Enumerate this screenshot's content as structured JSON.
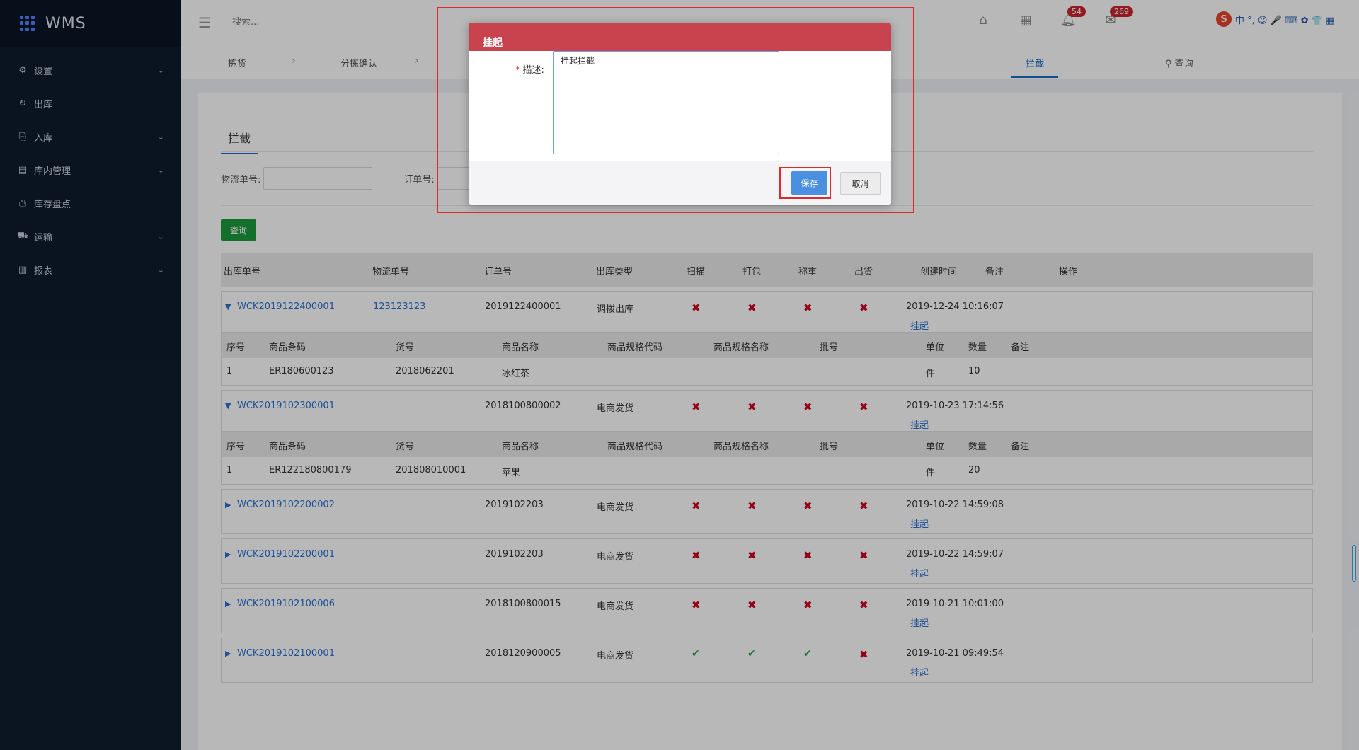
{
  "app": {
    "title": "WMS"
  },
  "sidebar": {
    "items": [
      {
        "label": "设置",
        "icon": "gear-icon",
        "glyph": "⚙",
        "chev": "⌄"
      },
      {
        "label": "出库",
        "icon": "outbound-icon",
        "glyph": "↻",
        "chev": ""
      },
      {
        "label": "入库",
        "icon": "inbound-icon",
        "glyph": "⎘",
        "chev": "⌄"
      },
      {
        "label": "库内管理",
        "icon": "warehouse-icon",
        "glyph": "▤",
        "chev": "⌄"
      },
      {
        "label": "库存盘点",
        "icon": "inventory-icon",
        "glyph": "⎙",
        "chev": ""
      },
      {
        "label": "运输",
        "icon": "truck-icon",
        "glyph": "⛟",
        "chev": "⌄"
      },
      {
        "label": "报表",
        "icon": "chart-icon",
        "glyph": "▥",
        "chev": "⌄"
      }
    ]
  },
  "topbar": {
    "search_placeholder": "搜索...",
    "badge_notify": "54",
    "badge_mail": "269"
  },
  "ime": {
    "s": "S",
    "text": "中 °, ☺ 🎤 ⌨ ✿ 👕 ▦"
  },
  "tabs": {
    "pick": "拣货",
    "sort_confirm": "分拣确认",
    "intercept": "拦截",
    "query": "查询",
    "arrow": "›"
  },
  "section": {
    "tab": "拦截"
  },
  "form": {
    "logistics_label": "物流单号:",
    "order_label": "订单号:",
    "query_button": "查询"
  },
  "table": {
    "headers": [
      "出库单号",
      "物流单号",
      "订单号",
      "出库类型",
      "扫描",
      "打包",
      "称重",
      "出货",
      "创建时间",
      "备注",
      "操作"
    ],
    "sub_headers": [
      "序号",
      "商品条码",
      "货号",
      "商品名称",
      "商品规格代码",
      "商品规格名称",
      "批号",
      "单位",
      "数量",
      "备注"
    ],
    "action": "挂起",
    "tri_down": "▼",
    "tri_right": "▶",
    "x_mark": "✖",
    "check_mark": "✔",
    "rows": [
      {
        "no": "WCK2019122400001",
        "logistics": "123123123",
        "order": "2019122400001",
        "type": "调拨出库",
        "marks": [
          "x",
          "x",
          "x",
          "x"
        ],
        "time": "2019-12-24 10:16:07",
        "expanded": true,
        "items": [
          {
            "seq": "1",
            "barcode": "ER180600123",
            "sku": "2018062201",
            "name": "冰红茶",
            "unit": "件",
            "qty": "10"
          }
        ]
      },
      {
        "no": "WCK2019102300001",
        "logistics": "",
        "order": "2018100800002",
        "type": "电商发货",
        "marks": [
          "x",
          "x",
          "x",
          "x"
        ],
        "time": "2019-10-23 17:14:56",
        "expanded": true,
        "items": [
          {
            "seq": "1",
            "barcode": "ER122180800179",
            "sku": "201808010001",
            "name": "苹果",
            "unit": "件",
            "qty": "20"
          }
        ]
      },
      {
        "no": "WCK2019102200002",
        "logistics": "",
        "order": "2019102203",
        "type": "电商发货",
        "marks": [
          "x",
          "x",
          "x",
          "x"
        ],
        "time": "2019-10-22 14:59:08",
        "expanded": false
      },
      {
        "no": "WCK2019102200001",
        "logistics": "",
        "order": "2019102203",
        "type": "电商发货",
        "marks": [
          "x",
          "x",
          "x",
          "x"
        ],
        "time": "2019-10-22 14:59:07",
        "expanded": false
      },
      {
        "no": "WCK2019102100006",
        "logistics": "",
        "order": "2018100800015",
        "type": "电商发货",
        "marks": [
          "x",
          "x",
          "x",
          "x"
        ],
        "time": "2019-10-21 10:01:00",
        "expanded": false
      },
      {
        "no": "WCK2019102100001",
        "logistics": "",
        "order": "2018120900005",
        "type": "电商发货",
        "marks": [
          "ok",
          "ok",
          "ok",
          "x"
        ],
        "time": "2019-10-21 09:49:54",
        "expanded": false
      }
    ]
  },
  "modal": {
    "title": "挂起",
    "required_mark": "*",
    "desc_label": "描述:",
    "desc_value": "挂起拦截",
    "save": "保存",
    "cancel": "取消"
  }
}
